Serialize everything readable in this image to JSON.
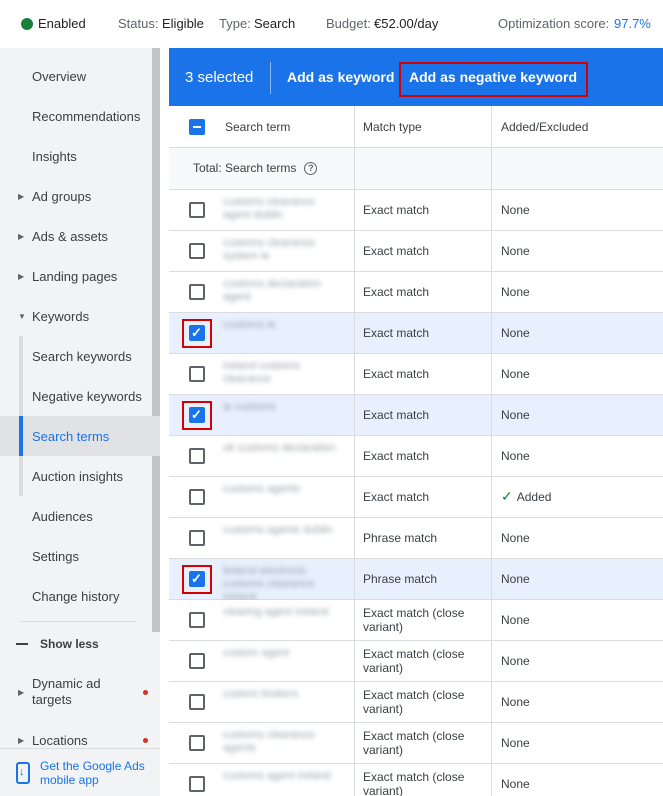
{
  "status_bar": {
    "enabled_label": "Enabled",
    "status_label": "Status:",
    "status_value": "Eligible",
    "type_label": "Type:",
    "type_value": "Search",
    "budget_label": "Budget:",
    "budget_value": "€52.00/day",
    "score_label": "Optimization score:",
    "score_value": "97.7%"
  },
  "sidebar": {
    "items": [
      {
        "label": "Overview"
      },
      {
        "label": "Recommendations"
      },
      {
        "label": "Insights"
      },
      {
        "label": "Ad groups"
      },
      {
        "label": "Ads & assets"
      },
      {
        "label": "Landing pages"
      },
      {
        "label": "Keywords"
      },
      {
        "label": "Search keywords"
      },
      {
        "label": "Negative keywords"
      },
      {
        "label": "Search terms"
      },
      {
        "label": "Auction insights"
      },
      {
        "label": "Audiences"
      },
      {
        "label": "Settings"
      },
      {
        "label": "Change history"
      },
      {
        "label": "Dynamic ad targets"
      },
      {
        "label": "Locations"
      }
    ],
    "show_less": "Show less",
    "mobile_app": "Get the Google Ads mobile app"
  },
  "selection_bar": {
    "count": "3 selected",
    "add_keyword": "Add as keyword",
    "add_negative": "Add as negative keyword"
  },
  "table": {
    "headers": {
      "term": "Search term",
      "match": "Match type",
      "added": "Added/Excluded"
    },
    "total_label": "Total: Search terms",
    "rows": [
      {
        "term": "customs clearance agent dublin",
        "match": "Exact match",
        "added": "None",
        "selected": false
      },
      {
        "term": "customs clearance system ie",
        "match": "Exact match",
        "added": "None",
        "selected": false
      },
      {
        "term": "customs declaration agent",
        "match": "Exact match",
        "added": "None",
        "selected": false
      },
      {
        "term": "customs ie",
        "match": "Exact match",
        "added": "None",
        "selected": true
      },
      {
        "term": "ireland customs clearance",
        "match": "Exact match",
        "added": "None",
        "selected": false
      },
      {
        "term": "ie customs",
        "match": "Exact match",
        "added": "None",
        "selected": true
      },
      {
        "term": "uk customs declaration",
        "match": "Exact match",
        "added": "None",
        "selected": false
      },
      {
        "term": "customs agents",
        "match": "Exact match",
        "added": "Added",
        "selected": false
      },
      {
        "term": "customs agents dublin",
        "match": "Phrase match",
        "added": "None",
        "selected": false
      },
      {
        "term": "federal electronic customs clearance ireland",
        "match": "Phrase match",
        "added": "None",
        "selected": true
      },
      {
        "term": "clearing agent ireland",
        "match": "Exact match (close variant)",
        "added": "None",
        "selected": false
      },
      {
        "term": "custom agent",
        "match": "Exact match (close variant)",
        "added": "None",
        "selected": false
      },
      {
        "term": "custom brokers",
        "match": "Exact match (close variant)",
        "added": "None",
        "selected": false
      },
      {
        "term": "customs clearance agents",
        "match": "Exact match (close variant)",
        "added": "None",
        "selected": false
      },
      {
        "term": "customs agent ireland",
        "match": "Exact match (close variant)",
        "added": "None",
        "selected": false
      }
    ]
  },
  "colors": {
    "accent": "#1a73e8",
    "highlight": "#d50000",
    "enabled": "#188038"
  }
}
